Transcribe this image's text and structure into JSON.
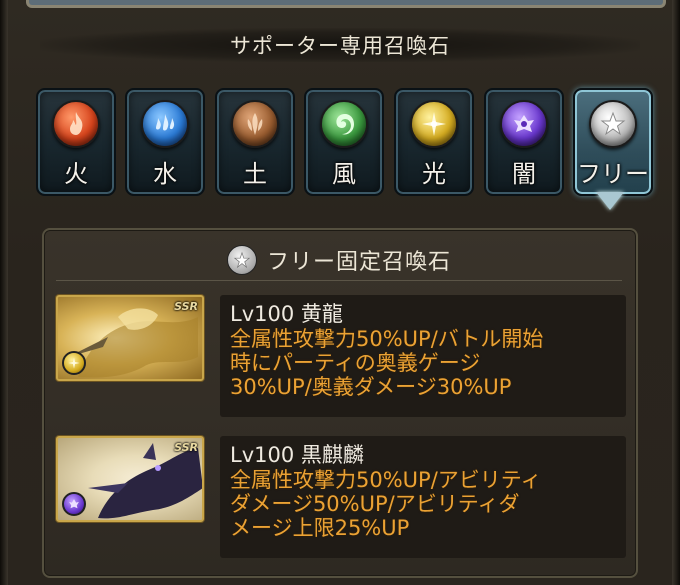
{
  "header": {
    "title": "サポーター専用召喚石"
  },
  "element_tabs": [
    {
      "label": "火",
      "icon": "fire-icon",
      "color": "#e2582c",
      "active": false
    },
    {
      "label": "水",
      "icon": "water-icon",
      "color": "#3c8be0",
      "active": false
    },
    {
      "label": "土",
      "icon": "earth-icon",
      "color": "#a0663a",
      "active": false
    },
    {
      "label": "風",
      "icon": "wind-icon",
      "color": "#3fa545",
      "active": false
    },
    {
      "label": "光",
      "icon": "light-icon",
      "color": "#e6c23a",
      "active": false
    },
    {
      "label": "闇",
      "icon": "dark-icon",
      "color": "#7a4ad8",
      "active": false
    },
    {
      "label": "フリー",
      "icon": "star-icon",
      "color": "#d8d8d8",
      "active": true
    }
  ],
  "panel": {
    "title": "フリー固定召喚石",
    "summons": [
      {
        "name": "Lv100 黄龍",
        "rarity": "SSR",
        "element_icon": "light-icon",
        "effect_lines": [
          "全属性攻撃力50%UP/バトル開始",
          "時にパーティの奥義ゲージ",
          "30%UP/奥義ダメージ30%UP"
        ]
      },
      {
        "name": "Lv100 黒麒麟",
        "rarity": "SSR",
        "element_icon": "dark-icon",
        "effect_lines": [
          "全属性攻撃力50%UP/アビリティ",
          "ダメージ50%UP/アビリティダ",
          "メージ上限25%UP"
        ]
      }
    ]
  },
  "colors": {
    "effect_text": "#eba234",
    "active_tab": "#4c6f7e"
  }
}
